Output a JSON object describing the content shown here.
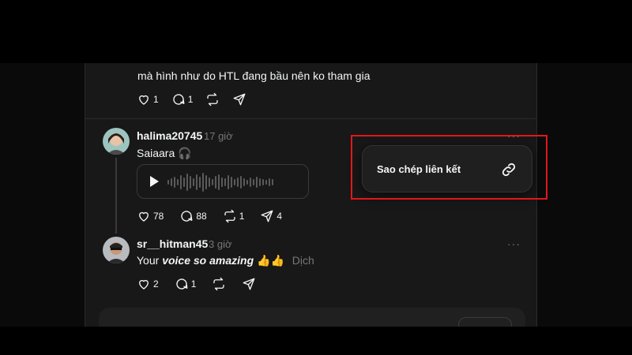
{
  "post1": {
    "text_line": "mà hình như do HTL đang bầu nên ko tham gia",
    "likes": "1",
    "comments": "1"
  },
  "reply1": {
    "username": "halima20745",
    "time": "17 giờ",
    "more": "···",
    "text": "Saiaara 🎧",
    "likes": "78",
    "comments": "88",
    "reposts": "1",
    "shares": "4"
  },
  "reply2": {
    "username": "sr__hitman45",
    "time": "3 giờ",
    "more": "···",
    "text_plain": "Your",
    "text_bold": "voice so amazing",
    "emoji": "👍👍",
    "translate": "Dịch",
    "likes": "2",
    "comments": "1"
  },
  "popup": {
    "label": "Sao chép liên kết",
    "icon": "link-icon"
  },
  "colors": {
    "background": "#181818",
    "text": "#f3f5f7",
    "muted": "#777777",
    "highlight": "#e3161b"
  }
}
